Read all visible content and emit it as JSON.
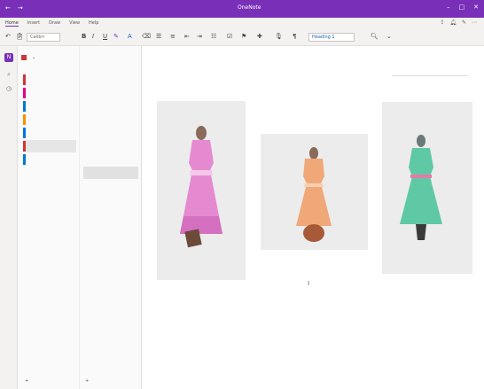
{
  "titlebar": {
    "app_title": "OneNote",
    "user": "",
    "left_icons": [
      "back-icon",
      "forward-icon"
    ],
    "controls": [
      "minimize-icon",
      "maximize-icon",
      "close-icon"
    ]
  },
  "menu": {
    "tabs": [
      "Home",
      "Insert",
      "Draw",
      "View",
      "Help"
    ],
    "active_tab": 0
  },
  "toolbar": {
    "font": "Calibri",
    "style": "Heading 1"
  },
  "notebook": {
    "name": "",
    "sections": [
      {
        "label": "",
        "color": "#d13438"
      },
      {
        "label": "",
        "color": "#e3008c"
      },
      {
        "label": "",
        "color": "#0078d4"
      },
      {
        "label": "",
        "color": "#ff8c00"
      },
      {
        "label": "",
        "color": "#0078d4"
      },
      {
        "label": "",
        "color": "#d13438"
      },
      {
        "label": "",
        "color": "#0078d4"
      }
    ],
    "active_section": 5,
    "add_section": ""
  },
  "pages": {
    "items": [
      "",
      "",
      "",
      "",
      "",
      "",
      "",
      ""
    ],
    "active_page": 7,
    "add_page": ""
  },
  "content": {
    "page_title": "",
    "dresses": [
      {
        "name": "pink-dress",
        "color": "#e58ad0"
      },
      {
        "name": "peach-dress",
        "color": "#f0a878"
      },
      {
        "name": "mint-dress",
        "color": "#5fc9a6"
      }
    ]
  }
}
